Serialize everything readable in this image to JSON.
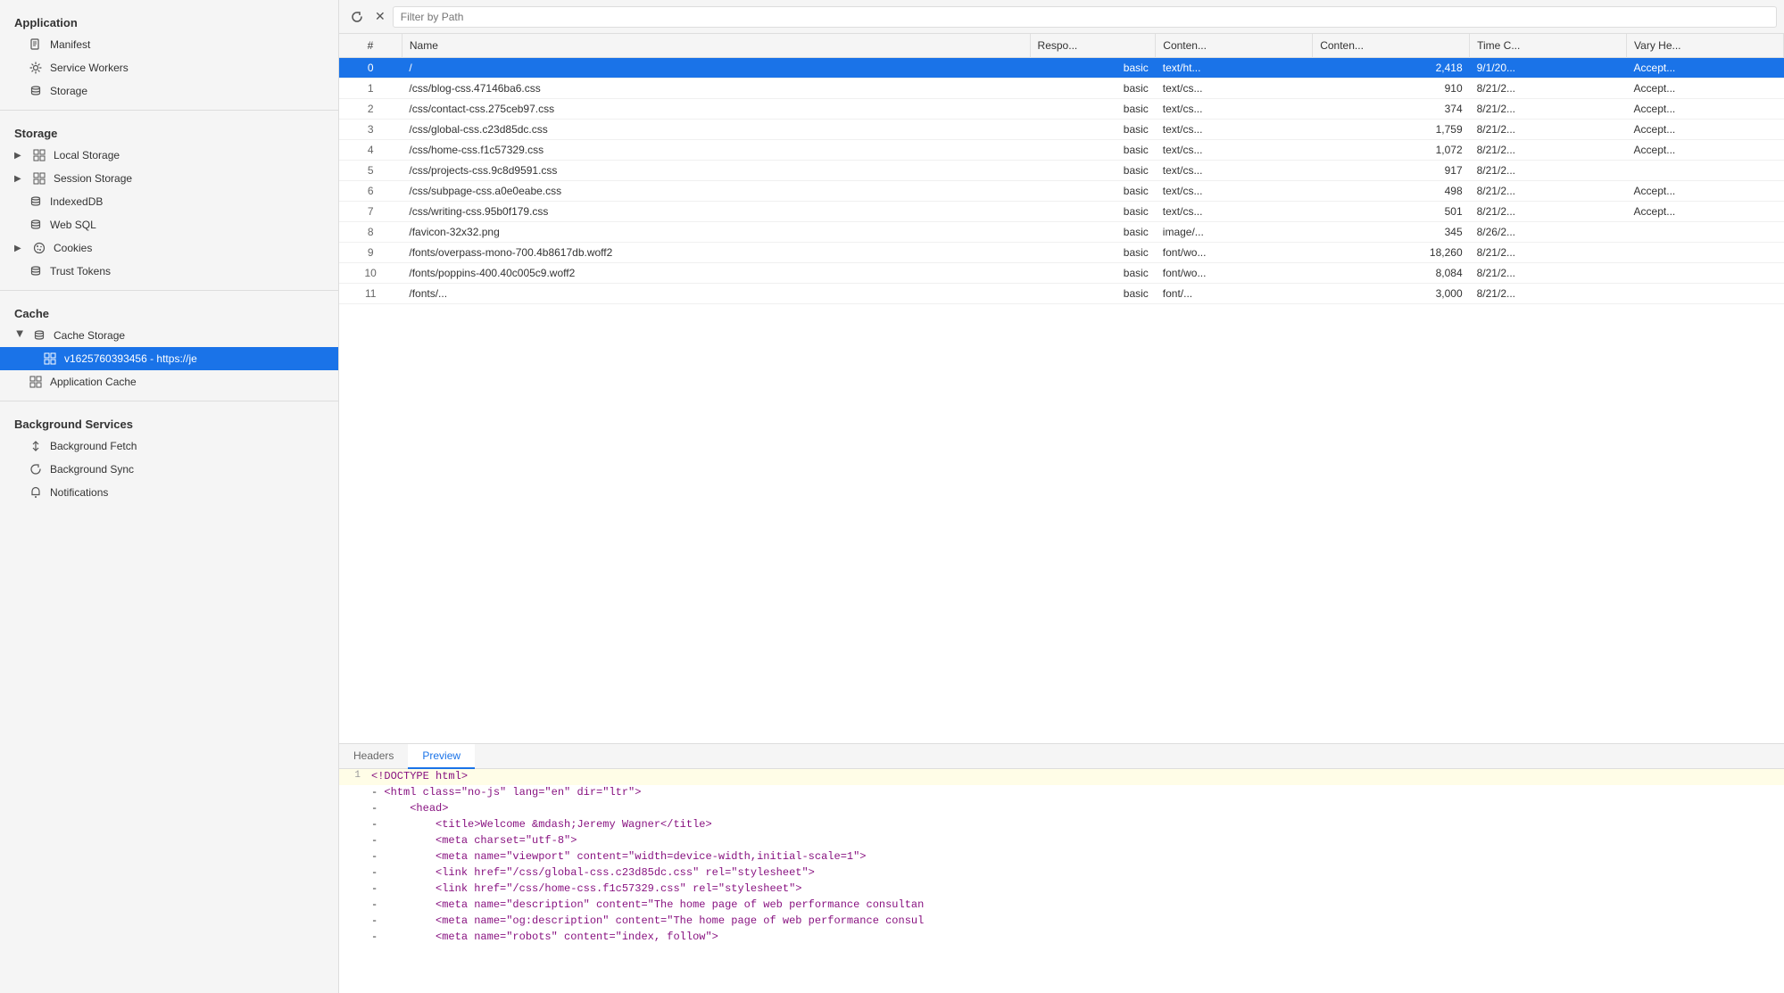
{
  "sidebar": {
    "sections": [
      {
        "title": "Application",
        "items": [
          {
            "id": "manifest",
            "label": "Manifest",
            "icon": "file-icon",
            "indent": 1,
            "expandable": false
          },
          {
            "id": "service-workers",
            "label": "Service Workers",
            "icon": "gear-icon",
            "indent": 1,
            "expandable": false
          },
          {
            "id": "storage",
            "label": "Storage",
            "icon": "db-icon",
            "indent": 1,
            "expandable": false
          }
        ]
      },
      {
        "title": "Storage",
        "items": [
          {
            "id": "local-storage",
            "label": "Local Storage",
            "icon": "grid-icon",
            "indent": 1,
            "expandable": true
          },
          {
            "id": "session-storage",
            "label": "Session Storage",
            "icon": "grid-icon",
            "indent": 1,
            "expandable": true
          },
          {
            "id": "indexeddb",
            "label": "IndexedDB",
            "icon": "db-icon",
            "indent": 1,
            "expandable": false
          },
          {
            "id": "web-sql",
            "label": "Web SQL",
            "icon": "db-icon",
            "indent": 1,
            "expandable": false
          },
          {
            "id": "cookies",
            "label": "Cookies",
            "icon": "cookie-icon",
            "indent": 1,
            "expandable": true
          },
          {
            "id": "trust-tokens",
            "label": "Trust Tokens",
            "icon": "db-icon",
            "indent": 1,
            "expandable": false
          }
        ]
      },
      {
        "title": "Cache",
        "items": [
          {
            "id": "cache-storage",
            "label": "Cache Storage",
            "icon": "db-icon",
            "indent": 1,
            "expandable": true,
            "expanded": true
          },
          {
            "id": "cache-v1625760393456",
            "label": "v1625760393456 - https://je",
            "icon": "grid-icon",
            "indent": 2,
            "expandable": false,
            "selected": true
          },
          {
            "id": "application-cache",
            "label": "Application Cache",
            "icon": "grid-icon",
            "indent": 1,
            "expandable": false
          }
        ]
      },
      {
        "title": "Background Services",
        "items": [
          {
            "id": "background-fetch",
            "label": "Background Fetch",
            "icon": "arrows-icon",
            "indent": 1,
            "expandable": false
          },
          {
            "id": "background-sync",
            "label": "Background Sync",
            "icon": "sync-icon",
            "indent": 1,
            "expandable": false
          },
          {
            "id": "notifications",
            "label": "Notifications",
            "icon": "bell-icon",
            "indent": 1,
            "expandable": false
          }
        ]
      }
    ]
  },
  "toolbar": {
    "refresh_label": "↻",
    "close_label": "✕",
    "filter_placeholder": "Filter by Path"
  },
  "table": {
    "columns": [
      "#",
      "Name",
      "Respo...",
      "Conten...",
      "Conten...",
      "Time C...",
      "Vary He..."
    ],
    "rows": [
      {
        "hash": "0",
        "name": "/",
        "response": "basic",
        "content_type": "text/ht...",
        "content_length": "2,418",
        "time": "9/1/20...",
        "vary": "Accept...",
        "selected": true
      },
      {
        "hash": "1",
        "name": "/css/blog-css.47146ba6.css",
        "response": "basic",
        "content_type": "text/cs...",
        "content_length": "910",
        "time": "8/21/2...",
        "vary": "Accept..."
      },
      {
        "hash": "2",
        "name": "/css/contact-css.275ceb97.css",
        "response": "basic",
        "content_type": "text/cs...",
        "content_length": "374",
        "time": "8/21/2...",
        "vary": "Accept..."
      },
      {
        "hash": "3",
        "name": "/css/global-css.c23d85dc.css",
        "response": "basic",
        "content_type": "text/cs...",
        "content_length": "1,759",
        "time": "8/21/2...",
        "vary": "Accept..."
      },
      {
        "hash": "4",
        "name": "/css/home-css.f1c57329.css",
        "response": "basic",
        "content_type": "text/cs...",
        "content_length": "1,072",
        "time": "8/21/2...",
        "vary": "Accept..."
      },
      {
        "hash": "5",
        "name": "/css/projects-css.9c8d9591.css",
        "response": "basic",
        "content_type": "text/cs...",
        "content_length": "917",
        "time": "8/21/2...",
        "vary": ""
      },
      {
        "hash": "6",
        "name": "/css/subpage-css.a0e0eabe.css",
        "response": "basic",
        "content_type": "text/cs...",
        "content_length": "498",
        "time": "8/21/2...",
        "vary": "Accept..."
      },
      {
        "hash": "7",
        "name": "/css/writing-css.95b0f179.css",
        "response": "basic",
        "content_type": "text/cs...",
        "content_length": "501",
        "time": "8/21/2...",
        "vary": "Accept..."
      },
      {
        "hash": "8",
        "name": "/favicon-32x32.png",
        "response": "basic",
        "content_type": "image/...",
        "content_length": "345",
        "time": "8/26/2...",
        "vary": ""
      },
      {
        "hash": "9",
        "name": "/fonts/overpass-mono-700.4b8617db.woff2",
        "response": "basic",
        "content_type": "font/wo...",
        "content_length": "18,260",
        "time": "8/21/2...",
        "vary": ""
      },
      {
        "hash": "10",
        "name": "/fonts/poppins-400.40c005c9.woff2",
        "response": "basic",
        "content_type": "font/wo...",
        "content_length": "8,084",
        "time": "8/21/2...",
        "vary": ""
      },
      {
        "hash": "11",
        "name": "/fonts/...",
        "response": "basic",
        "content_type": "font/...",
        "content_length": "3,000",
        "time": "8/21/2...",
        "vary": ""
      }
    ]
  },
  "panel": {
    "tabs": [
      "Headers",
      "Preview"
    ],
    "active_tab": "Preview",
    "code_lines": [
      {
        "number": "1",
        "indent": "",
        "dash": "",
        "content": "<!DOCTYPE html>",
        "type": "doctype",
        "highlighted": true
      },
      {
        "number": "",
        "indent": "",
        "dash": "-",
        "content": "<html class=\"no-js\" lang=\"en\" dir=\"ltr\">",
        "type": "tag"
      },
      {
        "number": "",
        "indent": "    ",
        "dash": "-",
        "content": "<head>",
        "type": "tag"
      },
      {
        "number": "",
        "indent": "        ",
        "dash": "-",
        "content": "<title>Welcome &mdash;Jeremy Wagner</title>",
        "type": "tag"
      },
      {
        "number": "",
        "indent": "        ",
        "dash": "-",
        "content": "<meta charset=\"utf-8\">",
        "type": "tag"
      },
      {
        "number": "",
        "indent": "        ",
        "dash": "-",
        "content": "<meta name=\"viewport\" content=\"width=device-width,initial-scale=1\">",
        "type": "tag"
      },
      {
        "number": "",
        "indent": "        ",
        "dash": "-",
        "content": "<link href=\"/css/global-css.c23d85dc.css\" rel=\"stylesheet\">",
        "type": "tag"
      },
      {
        "number": "",
        "indent": "        ",
        "dash": "-",
        "content": "<link href=\"/css/home-css.f1c57329.css\" rel=\"stylesheet\">",
        "type": "tag"
      },
      {
        "number": "",
        "indent": "        ",
        "dash": "-",
        "content": "<meta name=\"description\" content=\"The home page of web performance consultan",
        "type": "tag"
      },
      {
        "number": "",
        "indent": "        ",
        "dash": "-",
        "content": "<meta name=\"og:description\" content=\"The home page of web performance consul",
        "type": "tag"
      },
      {
        "number": "",
        "indent": "        ",
        "dash": "-",
        "content": "<meta name=\"robots\" content=\"index, follow\">",
        "type": "tag"
      }
    ]
  },
  "colors": {
    "selected_bg": "#1a73e8",
    "selected_text": "#ffffff",
    "highlight_bg": "#fffde7",
    "sidebar_bg": "#f5f5f5",
    "accent": "#1a73e8"
  }
}
